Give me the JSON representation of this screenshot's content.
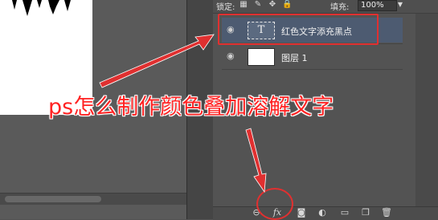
{
  "layers_panel": {
    "lock_label": "锁定:",
    "fill_label": "填充:",
    "fill_value": "100%",
    "layers": [
      {
        "name": "红色文字添充黑点",
        "type": "text",
        "thumb_glyph": "T",
        "selected": true
      },
      {
        "name": "图层 1",
        "type": "raster",
        "selected": false
      }
    ],
    "bottom_icons": [
      "link-icon",
      "fx-icon",
      "mask-icon",
      "adjustment-icon",
      "folder-icon",
      "new-layer-icon",
      "trash-icon"
    ],
    "fx_label": "fx"
  },
  "annotation": {
    "caption": "ps怎么制作颜色叠加溶解文字",
    "color": "#e03030"
  }
}
